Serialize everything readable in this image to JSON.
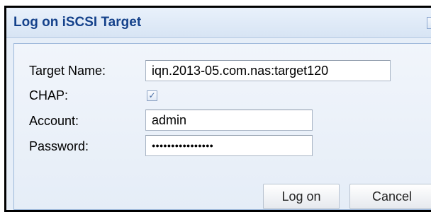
{
  "dialog": {
    "title": "Log on iSCSI Target",
    "close_glyph": "✕"
  },
  "form": {
    "target_name": {
      "label": "Target Name:",
      "value": "iqn.2013-05.com.nas:target120"
    },
    "chap": {
      "label": "CHAP:",
      "checked": true,
      "check_glyph": "✓"
    },
    "account": {
      "label": "Account:",
      "value": "admin"
    },
    "password": {
      "label": "Password:",
      "value": "●●●●●●●●●●●●●●●●"
    }
  },
  "buttons": {
    "logon": "Log on",
    "cancel": "Cancel"
  },
  "colors": {
    "title_text": "#15428b",
    "panel_bg": "#e6eef8"
  },
  "icons": {
    "close": "close-icon",
    "check": "checkmark-icon"
  }
}
